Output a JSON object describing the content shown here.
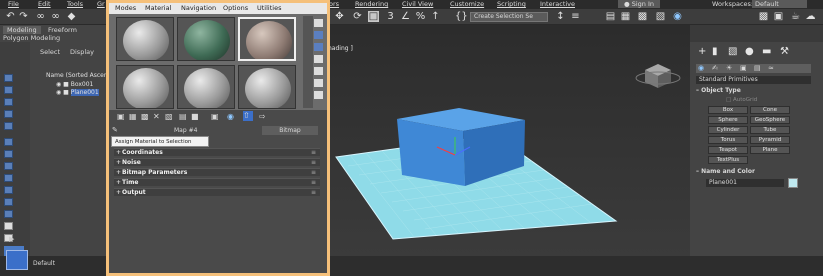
{
  "menubar": {
    "items": [
      "File",
      "Edit",
      "Tools",
      "Gr",
      "ors",
      "Rendering",
      "Civil View",
      "Customize",
      "Scripting",
      "Interactive"
    ],
    "signin": "Sign In",
    "workspaces_label": "Workspaces:",
    "workspace_value": "Default"
  },
  "toolbar": {
    "selection_set": "Create Selection Se"
  },
  "ribbon": {
    "tab1": "Modeling",
    "tab2": "Freeform",
    "subtitle": "Polygon Modeling"
  },
  "scene_explorer": {
    "select": "Select",
    "display": "Display",
    "column_header": "Name (Sorted Ascen",
    "items": [
      "Box001",
      "Plane001"
    ]
  },
  "viewport": {
    "label": "hading ]"
  },
  "material_editor": {
    "menu": [
      "Modes",
      "Material",
      "Navigation",
      "Options",
      "Utilities"
    ],
    "map_label": "Map #4",
    "bitmap_label": "Bitmap",
    "tooltip": "Assign Material to Selection",
    "rollouts": [
      "Coordinates",
      "Noise",
      "Bitmap Parameters",
      "Time",
      "Output"
    ]
  },
  "command_panel": {
    "dropdown": "Standard Primitives",
    "object_type_title": "Object Type",
    "autogrid": "AutoGrid",
    "buttons": [
      "Box",
      "Cone",
      "Sphere",
      "GeoSphere",
      "Cylinder",
      "Tube",
      "Torus",
      "Pyramid",
      "Teapot",
      "Plane",
      "TextPlus"
    ],
    "name_color_title": "Name and Color",
    "object_name": "Plane001",
    "object_color": "#bfe9ef"
  },
  "status": {
    "layer": "Default"
  },
  "colors": {
    "accent": "#f5c07a",
    "plane": "#7fd6e6",
    "box": "#4b8fd6",
    "selected_blue": "#3b6fc9"
  }
}
